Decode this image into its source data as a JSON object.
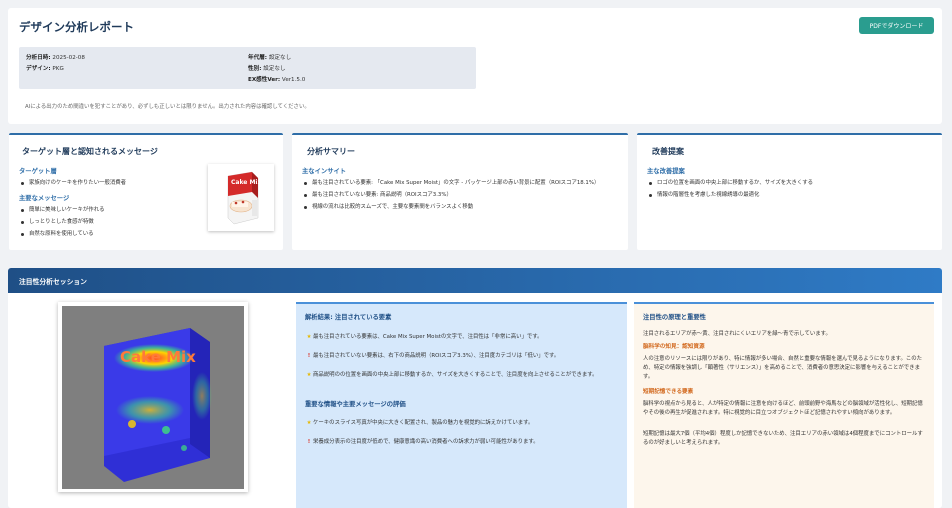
{
  "header": {
    "title": "デザイン分析レポート",
    "download_button": "PDFでダウンロード",
    "meta": {
      "date_label": "分析日時:",
      "date_value": "2025-02-08",
      "design_label": "デザイン:",
      "design_value": "PKG",
      "age_label": "年代層:",
      "age_value": "設定なし",
      "gender_label": "性別:",
      "gender_value": "設定なし",
      "version_label": "EX感性Ver:",
      "version_value": "Ver1.5.0"
    },
    "disclaimer": "AIによる出力のため間違いを犯すことがあり、必ずしも正しいとは限りません。出力された内容は確認してください。"
  },
  "cards": {
    "target": {
      "title": "ターゲット層と認知されるメッセージ",
      "sub1": "ターゲット層",
      "items1": [
        "家族向けのケーキを作りたい一般消費者"
      ],
      "sub2": "主要なメッセージ",
      "items2": [
        "簡単に美味しいケーキが作れる",
        "しっとりとした食感が特徴",
        "自然な原料を使用している"
      ]
    },
    "summary": {
      "title": "分析サマリー",
      "sub1": "主なインサイト",
      "items1": [
        "最も注目されている要素: 「Cake Mix Super Moist」の文字 - パッケージ上部の赤い背景に配置（ROIスコア18.1%）",
        "最も注目されていない要素: 商品説明（ROIスコア3.3%）",
        "視線の流れは比較的スムーズで、主要な要素間をバランスよく移動"
      ]
    },
    "improve": {
      "title": "改善提案",
      "sub1": "主な改善提案",
      "items1": [
        "ロゴの位置を画面の中央上部に移動するか、サイズを大きくする",
        "情報の階層性を考慮した視線誘導の最適化"
      ]
    }
  },
  "section": {
    "title": "注目性分析セッション",
    "thumb_text": "Cake Mix",
    "heat_text": "Cake Mix",
    "analysis": {
      "title": "解析結果: 注目されている要素",
      "p1": "最も注目されている要素は、Cake Mix Super Moistの文字で、注目性は「非常に高い」です。",
      "p2": "最も注目されていない要素は、右下の商品説明（ROIスコア3.3%）、注目度カテゴリは「低い」です。",
      "p3": "商品説明のの位置を画面の中央上部に移動するか、サイズを大きくすることで、注目度を向上させることができます。",
      "title2": "重要な情報や主要メッセージの評価",
      "p4": "ケーキのスライス写真が中央に大きく配置され、製品の魅力を視覚的に訴えかけています。",
      "p5": "栄養成分表示の注目度が低めで、健康意識の高い消費者への訴求力が弱い可能性があります。"
    },
    "principle": {
      "title": "注目性の原理と重要性",
      "p1": "注目されるエリアが赤〜黄、注目されにくいエリアを緑〜青で示しています。",
      "sub1": "脳科学の知見：認知資源",
      "p2": "人の注意のリソースには限りがあり、特に情報が多い場合、自然と重要な情報を選んで見るようになります。このため、特定の情報を強調し「顕著性（サリエンス）」を高めることで、消費者の意思決定に影響を与えることができます。",
      "sub2": "短期記憶できる要素",
      "p3": "脳科学の視点から見ると、人が特定の情報に注意を向けるほど、前頭前野や海馬などの脳領域が活性化し、短期記憶やその後の再生が促進されます。特に視覚的に目立つオブジェクトほど記憶されやすい傾向があります。",
      "p4": "短期記憶は最大7個（平均4個）程度しか記憶できないため、注目エリアの赤い領域は4個程度までにコントロールするのが好ましいと考えられます。"
    }
  },
  "colors": {
    "accent": "#2a9d8f",
    "brand": "#1f4f86",
    "card_border": "#2f6ea8"
  }
}
